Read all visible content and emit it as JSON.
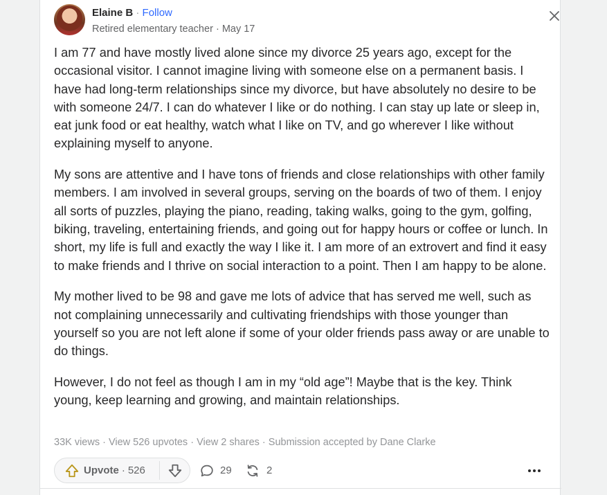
{
  "author": {
    "name": "Elaine B",
    "separator": "·",
    "follow_label": "Follow",
    "credential": "Retired elementary teacher",
    "date": "May 17"
  },
  "content": {
    "paragraphs": [
      "I am 77 and have mostly lived alone since my divorce 25 years ago, except for the occasional visitor. I cannot imagine living with someone else on a permanent basis. I have had long-term relationships since my divorce, but have absolutely no desire to be with someone 24/7. I can do whatever I like or do nothing. I can stay up late or sleep in, eat junk food or eat healthy, watch what I like on TV, and go wherever I like without explaining myself to anyone.",
      "My sons are attentive and I have tons of friends and close relationships with other family members. I am involved in several groups, serving on the boards of two of them. I enjoy all sorts of puzzles, playing the piano, reading, taking walks, going to the gym, golfing, biking, traveling, entertaining friends, and going out for happy hours or coffee or lunch. In short, my life is full and exactly the way I like it. I am more of an extrovert and find it easy to make friends and I thrive on social interaction to a point. Then I am happy to be alone.",
      "My mother lived to be 98 and gave me lots of advice that has served me well, such as not complaining unnecessarily and cultivating friendships with those younger than yourself so you are not left alone if some of your older friends pass away or are unable to do things.",
      "However, I do not feel as though I am in my “old age”! Maybe that is the key. Think young, keep learning and growing, and maintain relationships."
    ]
  },
  "stats": {
    "views": "33K views",
    "upvotes_link": "View 526 upvotes",
    "shares_link": "View 2 shares",
    "submission": "Submission accepted by Dane Clarke",
    "separator": " · "
  },
  "actions": {
    "upvote_label": "Upvote",
    "upvote_separator": "·",
    "upvote_count": "526",
    "comment_count": "29",
    "share_count": "2"
  },
  "icons": {
    "close": "close-icon",
    "upvote": "upvote-arrow-icon",
    "downvote": "downvote-arrow-icon",
    "comment": "comment-bubble-icon",
    "share": "share-cycle-icon",
    "more": "more-dots-icon"
  },
  "colors": {
    "link": "#2e69ff",
    "upvote_icon": "#b9961a",
    "text": "#282829",
    "muted": "#939598"
  }
}
